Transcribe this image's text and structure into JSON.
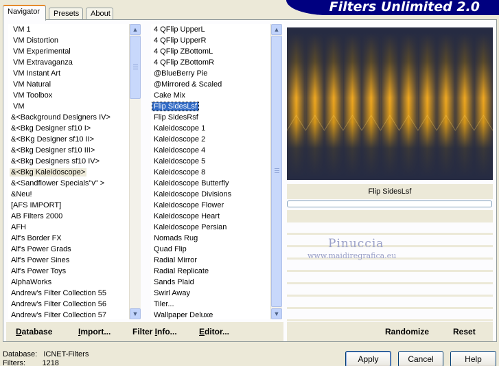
{
  "tabs": [
    "Navigator",
    "Presets",
    "About"
  ],
  "banner_title": "Filters Unlimited 2.0",
  "categories": [
    "VM 1",
    "VM Distortion",
    "VM Experimental",
    "VM Extravaganza",
    "VM Instant Art",
    "VM Natural",
    "VM Toolbox",
    "VM",
    "&<Background Designers IV>",
    "&<Bkg Designer sf10 I>",
    "&<BKg Designer sf10 II>",
    "&<Bkg Designer sf10 III>",
    "&<Bkg Designers sf10 IV>",
    "&<Bkg Kaleidoscope>",
    "&<Sandflower Specials\"v\" >",
    "&Neu!",
    "[AFS IMPORT]",
    "AB Filters 2000",
    "AFH",
    "Alf's Border FX",
    "Alf's Power Grads",
    "Alf's Power Sines",
    "Alf's Power Toys",
    "AlphaWorks",
    "Andrew's Filter Collection 55",
    "Andrew's Filter Collection 56",
    "Andrew's Filter Collection 57"
  ],
  "categories_highlighted_index": 13,
  "filters": [
    "4 QFlip UpperL",
    "4 QFlip UpperR",
    "4 QFlip ZBottomL",
    "4 QFlip ZBottomR",
    "@BlueBerry Pie",
    "@Mirrored & Scaled",
    "Cake Mix",
    "Flip SidesLsf",
    "Flip SidesRsf",
    "Kaleidoscope 1",
    "Kaleidoscope 2",
    "Kaleidoscope 4",
    "Kaleidoscope 5",
    "Kaleidoscope 8",
    "Kaleidoscope Butterfly",
    "Kaleidoscope Divisions",
    "Kaleidoscope Flower",
    "Kaleidoscope Heart",
    "Kaleidoscope Persian",
    "Nomads Rug",
    "Quad Flip",
    "Radial Mirror",
    "Radial Replicate",
    "Sands Plaid",
    "Swirl Away",
    "Tiler...",
    "Wallpaper Deluxe"
  ],
  "filters_selected_index": 7,
  "nav_buttons": {
    "database": {
      "u": "D",
      "rest": "atabase"
    },
    "import": {
      "u": "I",
      "rest": "mport..."
    },
    "filter_info": {
      "pre": "Filter ",
      "u": "I",
      "rest": "nfo..."
    },
    "editor": {
      "u": "E",
      "rest": "ditor..."
    }
  },
  "preview_filter_name": "Flip SidesLsf",
  "watermark": {
    "line1": "Pinuccia",
    "line2": "www.maidiregrafica.eu"
  },
  "randomize_label": "Randomize",
  "reset_label": "Reset",
  "status": {
    "database_label": "Database:",
    "database_value": "ICNET-Filters",
    "filters_label": "Filters:",
    "filters_value": "1218"
  },
  "buttons": {
    "apply": "Apply",
    "cancel": "Cancel",
    "help": "Help"
  },
  "colors": {
    "selection": "#316ac5",
    "banner": "#000080",
    "preview_bg": "#262b42",
    "preview_gold": "#f0a820"
  }
}
